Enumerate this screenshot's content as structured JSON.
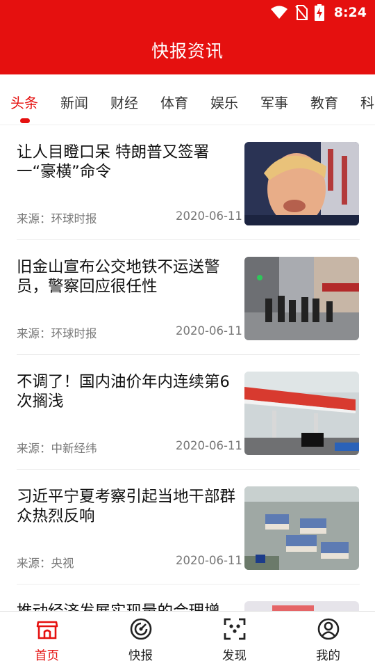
{
  "status_bar": {
    "time": "8:24"
  },
  "header": {
    "title": "快报资讯"
  },
  "tabs": [
    "头条",
    "新闻",
    "财经",
    "体育",
    "娱乐",
    "军事",
    "教育",
    "科"
  ],
  "news": [
    {
      "title": "让人目瞪口呆 特朗普又签署一“豪横”命令",
      "source": "来源：环球时报",
      "date": "2020-06-11"
    },
    {
      "title": "旧金山宣布公交地铁不运送警员，警察回应很任性",
      "source": "来源：环球时报",
      "date": "2020-06-11"
    },
    {
      "title": "不调了！国内油价年内连续第6次搁浅",
      "source": "来源：中新经纬",
      "date": "2020-06-11"
    },
    {
      "title": "习近平宁夏考察引起当地干部群众热烈反响",
      "source": "来源：央视",
      "date": "2020-06-11"
    },
    {
      "title": "推动经济发展实现量的合理增",
      "source": "",
      "date": ""
    }
  ],
  "bottom_nav": [
    {
      "label": "首页",
      "icon": "home-icon"
    },
    {
      "label": "快报",
      "icon": "radar-icon"
    },
    {
      "label": "发现",
      "icon": "scan-icon"
    },
    {
      "label": "我的",
      "icon": "user-icon"
    }
  ],
  "colors": {
    "primary": "#e5100f",
    "text": "#111111",
    "meta": "#777777"
  }
}
